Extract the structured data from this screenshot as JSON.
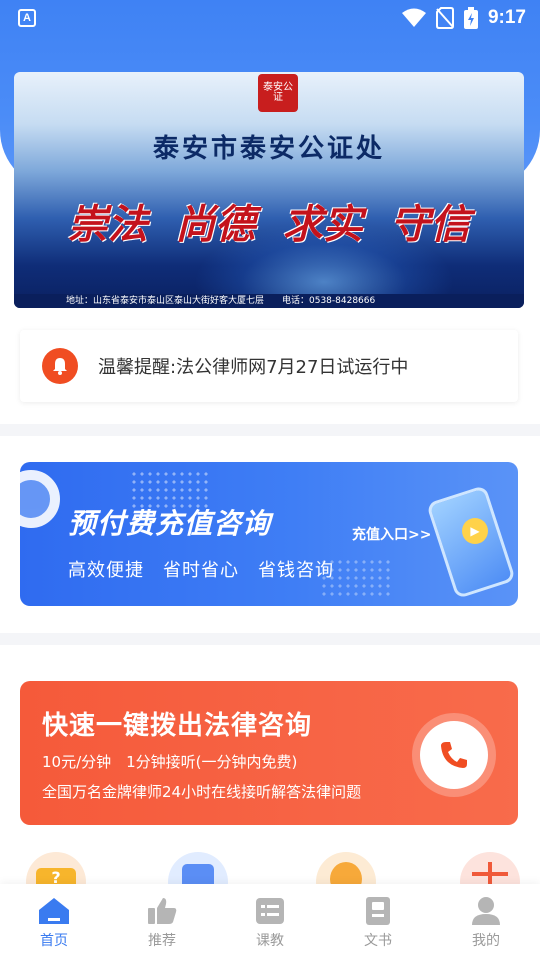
{
  "status_bar": {
    "time": "9:17"
  },
  "banner": {
    "seal_text": "泰安公证",
    "title": "泰安市泰安公证处",
    "motto": [
      "崇法",
      "尚德",
      "求实",
      "守信"
    ],
    "footer": "地址：山东省泰安市泰山区泰山大街好客大厦七层　　电话：0538-8428666"
  },
  "notice": {
    "text": "温馨提醒:法公律师网7月27日试运行中"
  },
  "prepay": {
    "title": "预付费充值咨询",
    "subtitle": "高效便捷　省时省心　省钱咨询",
    "link": "充值入口>>"
  },
  "consult": {
    "title": "快速一键拨出法律咨询",
    "line1": "10元/分钟　1分钟接听(一分钟内免费)",
    "line2": "全国万名金牌律师24小时在线接听解答法律问题"
  },
  "colors": {
    "primary": "#3a7bf0",
    "accent": "#f55a3a",
    "notice_bell": "#f04d22"
  },
  "tabbar": {
    "items": [
      {
        "label": "首页",
        "icon": "home-icon",
        "active": true
      },
      {
        "label": "推荐",
        "icon": "thumbs-up-icon",
        "active": false
      },
      {
        "label": "课教",
        "icon": "list-icon",
        "active": false
      },
      {
        "label": "文书",
        "icon": "document-icon",
        "active": false
      },
      {
        "label": "我的",
        "icon": "person-icon",
        "active": false
      }
    ]
  }
}
